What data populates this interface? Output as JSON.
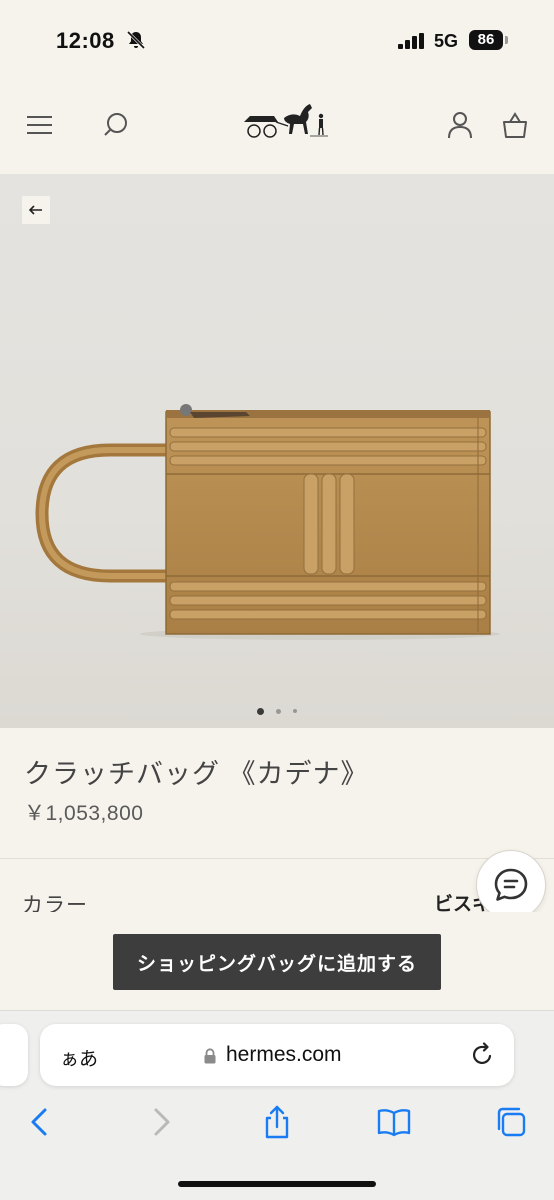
{
  "status_bar": {
    "time": "12:08",
    "network": "5G",
    "battery": "86"
  },
  "header": {
    "icons": [
      "menu-icon",
      "search-icon",
      "account-icon",
      "shopping-bag-icon"
    ],
    "logo": "hermes-carriage-logo"
  },
  "hero": {
    "image": "clutch-bag-product-photo",
    "carousel": {
      "total": 3,
      "active": 1
    }
  },
  "product": {
    "name": "クラッチバッグ 《カデナ》",
    "price": "￥1,053,800",
    "color_label": "カラー",
    "color_value": "ビスキュイ"
  },
  "actions": {
    "add_to_bag": "ショッピングバッグに追加する"
  },
  "browser": {
    "aa_label": "ぁあ",
    "url": "hermes.com",
    "toolbar_icons": [
      "back-icon",
      "forward-icon",
      "share-icon",
      "bookmarks-icon",
      "tabs-icon"
    ]
  },
  "colors": {
    "background": "#f6f2ec",
    "button": "#3d3d3d",
    "bag_leather": "#b58a4e"
  }
}
